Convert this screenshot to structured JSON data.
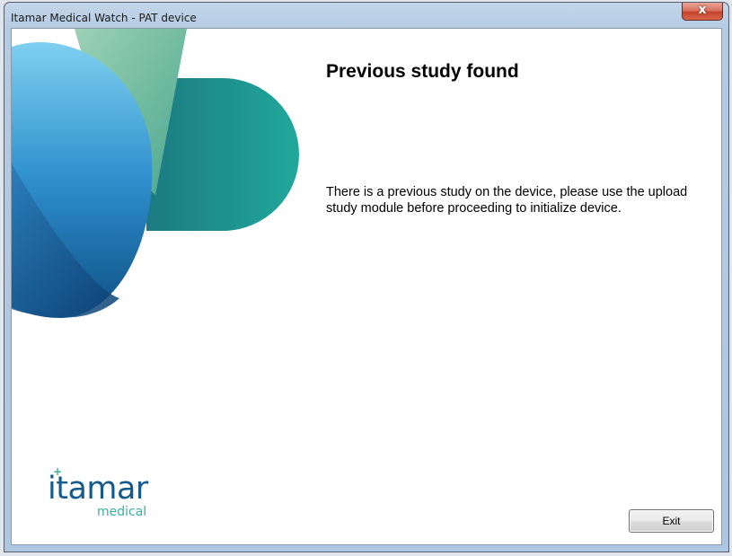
{
  "window": {
    "title": "Itamar Medical Watch - PAT device",
    "close_label": "x"
  },
  "main": {
    "heading": "Previous study found",
    "message": "There is a previous study on the device, please use the upload study module before proceeding to initialize device."
  },
  "logo": {
    "name": "itamar",
    "subtitle": "medical",
    "mark": "+"
  },
  "buttons": {
    "exit_label": "Exit"
  },
  "colors": {
    "brand_blue": "#155a8a",
    "brand_teal": "#38b0a0"
  }
}
